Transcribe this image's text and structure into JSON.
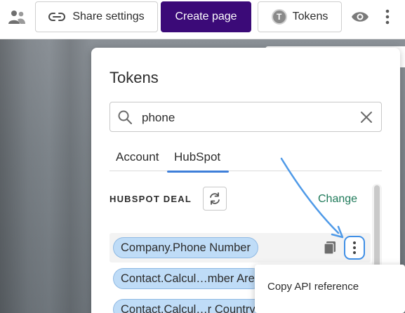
{
  "toolbar": {
    "share_label": "Share settings",
    "create_label": "Create page",
    "tokens_label": "Tokens",
    "tokens_badge": "T",
    "icons": [
      "people-icon",
      "link-icon",
      "eye-icon",
      "more-vertical-icon"
    ]
  },
  "tokens_panel": {
    "title": "Tokens",
    "search": {
      "value": "phone"
    },
    "tabs": [
      {
        "label": "Account",
        "active": false
      },
      {
        "label": "HubSpot",
        "active": true
      }
    ],
    "section_label": "HUBSPOT DEAL",
    "change_label": "Change",
    "tokens": [
      {
        "label": "Company.Phone Number"
      },
      {
        "label": "Contact.Calcul…mber Are"
      },
      {
        "label": "Contact.Calcul…r Country Code"
      }
    ]
  },
  "context_menu": {
    "items": [
      {
        "label": "Copy API reference"
      }
    ]
  },
  "colors": {
    "primary_button": "#3b0a78",
    "tab_underline": "#3f7fd9",
    "link": "#1f7a5a",
    "chip_fill": "#bfdcf7",
    "highlight": "#3f8fe6"
  }
}
